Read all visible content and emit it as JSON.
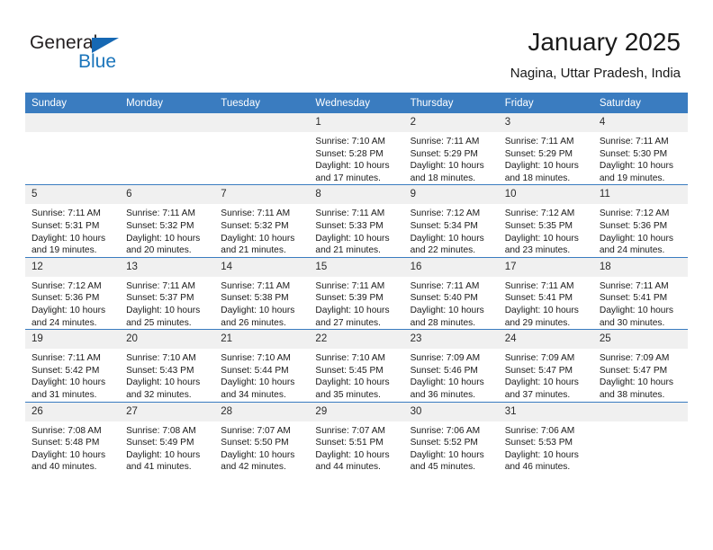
{
  "brand": {
    "name_part1": "General",
    "name_part2": "Blue",
    "color_blue": "#1b75bb",
    "color_triangle": "#1668b3"
  },
  "header": {
    "title": "January 2025",
    "location": "Nagina, Uttar Pradesh, India"
  },
  "theme": {
    "header_row_bg": "#3a7cc0",
    "daynum_bg": "#f0f0f0",
    "grid_line": "#3a7cc0"
  },
  "weekday_headers": [
    "Sunday",
    "Monday",
    "Tuesday",
    "Wednesday",
    "Thursday",
    "Friday",
    "Saturday"
  ],
  "weeks": [
    [
      {
        "day": "",
        "sunrise": "",
        "sunset": "",
        "daylight1": "",
        "daylight2": "",
        "empty": true
      },
      {
        "day": "",
        "sunrise": "",
        "sunset": "",
        "daylight1": "",
        "daylight2": "",
        "empty": true
      },
      {
        "day": "",
        "sunrise": "",
        "sunset": "",
        "daylight1": "",
        "daylight2": "",
        "empty": true
      },
      {
        "day": "1",
        "sunrise": "Sunrise: 7:10 AM",
        "sunset": "Sunset: 5:28 PM",
        "daylight1": "Daylight: 10 hours",
        "daylight2": "and 17 minutes.",
        "empty": false
      },
      {
        "day": "2",
        "sunrise": "Sunrise: 7:11 AM",
        "sunset": "Sunset: 5:29 PM",
        "daylight1": "Daylight: 10 hours",
        "daylight2": "and 18 minutes.",
        "empty": false
      },
      {
        "day": "3",
        "sunrise": "Sunrise: 7:11 AM",
        "sunset": "Sunset: 5:29 PM",
        "daylight1": "Daylight: 10 hours",
        "daylight2": "and 18 minutes.",
        "empty": false
      },
      {
        "day": "4",
        "sunrise": "Sunrise: 7:11 AM",
        "sunset": "Sunset: 5:30 PM",
        "daylight1": "Daylight: 10 hours",
        "daylight2": "and 19 minutes.",
        "empty": false
      }
    ],
    [
      {
        "day": "5",
        "sunrise": "Sunrise: 7:11 AM",
        "sunset": "Sunset: 5:31 PM",
        "daylight1": "Daylight: 10 hours",
        "daylight2": "and 19 minutes.",
        "empty": false
      },
      {
        "day": "6",
        "sunrise": "Sunrise: 7:11 AM",
        "sunset": "Sunset: 5:32 PM",
        "daylight1": "Daylight: 10 hours",
        "daylight2": "and 20 minutes.",
        "empty": false
      },
      {
        "day": "7",
        "sunrise": "Sunrise: 7:11 AM",
        "sunset": "Sunset: 5:32 PM",
        "daylight1": "Daylight: 10 hours",
        "daylight2": "and 21 minutes.",
        "empty": false
      },
      {
        "day": "8",
        "sunrise": "Sunrise: 7:11 AM",
        "sunset": "Sunset: 5:33 PM",
        "daylight1": "Daylight: 10 hours",
        "daylight2": "and 21 minutes.",
        "empty": false
      },
      {
        "day": "9",
        "sunrise": "Sunrise: 7:12 AM",
        "sunset": "Sunset: 5:34 PM",
        "daylight1": "Daylight: 10 hours",
        "daylight2": "and 22 minutes.",
        "empty": false
      },
      {
        "day": "10",
        "sunrise": "Sunrise: 7:12 AM",
        "sunset": "Sunset: 5:35 PM",
        "daylight1": "Daylight: 10 hours",
        "daylight2": "and 23 minutes.",
        "empty": false
      },
      {
        "day": "11",
        "sunrise": "Sunrise: 7:12 AM",
        "sunset": "Sunset: 5:36 PM",
        "daylight1": "Daylight: 10 hours",
        "daylight2": "and 24 minutes.",
        "empty": false
      }
    ],
    [
      {
        "day": "12",
        "sunrise": "Sunrise: 7:12 AM",
        "sunset": "Sunset: 5:36 PM",
        "daylight1": "Daylight: 10 hours",
        "daylight2": "and 24 minutes.",
        "empty": false
      },
      {
        "day": "13",
        "sunrise": "Sunrise: 7:11 AM",
        "sunset": "Sunset: 5:37 PM",
        "daylight1": "Daylight: 10 hours",
        "daylight2": "and 25 minutes.",
        "empty": false
      },
      {
        "day": "14",
        "sunrise": "Sunrise: 7:11 AM",
        "sunset": "Sunset: 5:38 PM",
        "daylight1": "Daylight: 10 hours",
        "daylight2": "and 26 minutes.",
        "empty": false
      },
      {
        "day": "15",
        "sunrise": "Sunrise: 7:11 AM",
        "sunset": "Sunset: 5:39 PM",
        "daylight1": "Daylight: 10 hours",
        "daylight2": "and 27 minutes.",
        "empty": false
      },
      {
        "day": "16",
        "sunrise": "Sunrise: 7:11 AM",
        "sunset": "Sunset: 5:40 PM",
        "daylight1": "Daylight: 10 hours",
        "daylight2": "and 28 minutes.",
        "empty": false
      },
      {
        "day": "17",
        "sunrise": "Sunrise: 7:11 AM",
        "sunset": "Sunset: 5:41 PM",
        "daylight1": "Daylight: 10 hours",
        "daylight2": "and 29 minutes.",
        "empty": false
      },
      {
        "day": "18",
        "sunrise": "Sunrise: 7:11 AM",
        "sunset": "Sunset: 5:41 PM",
        "daylight1": "Daylight: 10 hours",
        "daylight2": "and 30 minutes.",
        "empty": false
      }
    ],
    [
      {
        "day": "19",
        "sunrise": "Sunrise: 7:11 AM",
        "sunset": "Sunset: 5:42 PM",
        "daylight1": "Daylight: 10 hours",
        "daylight2": "and 31 minutes.",
        "empty": false
      },
      {
        "day": "20",
        "sunrise": "Sunrise: 7:10 AM",
        "sunset": "Sunset: 5:43 PM",
        "daylight1": "Daylight: 10 hours",
        "daylight2": "and 32 minutes.",
        "empty": false
      },
      {
        "day": "21",
        "sunrise": "Sunrise: 7:10 AM",
        "sunset": "Sunset: 5:44 PM",
        "daylight1": "Daylight: 10 hours",
        "daylight2": "and 34 minutes.",
        "empty": false
      },
      {
        "day": "22",
        "sunrise": "Sunrise: 7:10 AM",
        "sunset": "Sunset: 5:45 PM",
        "daylight1": "Daylight: 10 hours",
        "daylight2": "and 35 minutes.",
        "empty": false
      },
      {
        "day": "23",
        "sunrise": "Sunrise: 7:09 AM",
        "sunset": "Sunset: 5:46 PM",
        "daylight1": "Daylight: 10 hours",
        "daylight2": "and 36 minutes.",
        "empty": false
      },
      {
        "day": "24",
        "sunrise": "Sunrise: 7:09 AM",
        "sunset": "Sunset: 5:47 PM",
        "daylight1": "Daylight: 10 hours",
        "daylight2": "and 37 minutes.",
        "empty": false
      },
      {
        "day": "25",
        "sunrise": "Sunrise: 7:09 AM",
        "sunset": "Sunset: 5:47 PM",
        "daylight1": "Daylight: 10 hours",
        "daylight2": "and 38 minutes.",
        "empty": false
      }
    ],
    [
      {
        "day": "26",
        "sunrise": "Sunrise: 7:08 AM",
        "sunset": "Sunset: 5:48 PM",
        "daylight1": "Daylight: 10 hours",
        "daylight2": "and 40 minutes.",
        "empty": false
      },
      {
        "day": "27",
        "sunrise": "Sunrise: 7:08 AM",
        "sunset": "Sunset: 5:49 PM",
        "daylight1": "Daylight: 10 hours",
        "daylight2": "and 41 minutes.",
        "empty": false
      },
      {
        "day": "28",
        "sunrise": "Sunrise: 7:07 AM",
        "sunset": "Sunset: 5:50 PM",
        "daylight1": "Daylight: 10 hours",
        "daylight2": "and 42 minutes.",
        "empty": false
      },
      {
        "day": "29",
        "sunrise": "Sunrise: 7:07 AM",
        "sunset": "Sunset: 5:51 PM",
        "daylight1": "Daylight: 10 hours",
        "daylight2": "and 44 minutes.",
        "empty": false
      },
      {
        "day": "30",
        "sunrise": "Sunrise: 7:06 AM",
        "sunset": "Sunset: 5:52 PM",
        "daylight1": "Daylight: 10 hours",
        "daylight2": "and 45 minutes.",
        "empty": false
      },
      {
        "day": "31",
        "sunrise": "Sunrise: 7:06 AM",
        "sunset": "Sunset: 5:53 PM",
        "daylight1": "Daylight: 10 hours",
        "daylight2": "and 46 minutes.",
        "empty": false
      },
      {
        "day": "",
        "sunrise": "",
        "sunset": "",
        "daylight1": "",
        "daylight2": "",
        "empty": true
      }
    ]
  ]
}
